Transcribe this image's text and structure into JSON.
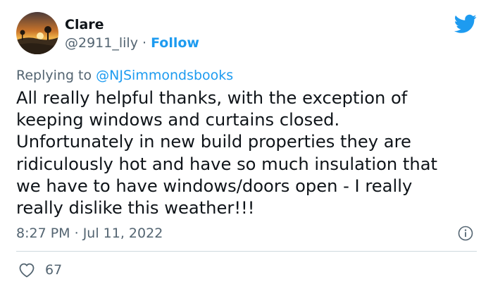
{
  "author": {
    "name": "Clare",
    "handle": "@2911_lily",
    "separator": "·",
    "follow_label": "Follow"
  },
  "reply": {
    "prefix": "Replying to",
    "handle": "@NJSimmondsbooks"
  },
  "tweet": {
    "text": "All really helpful thanks, with the exception of\nkeeping windows and curtains closed.\nUnfortunately in new build properties they are\nridiculously hot and have so much insulation that\nwe have to have windows/doors open - I really\nreally dislike this weather!!!"
  },
  "timestamp": {
    "time": "8:27 PM",
    "separator": "·",
    "date": "Jul 11, 2022"
  },
  "engagement": {
    "likes": "67"
  },
  "icons": {
    "brand": "twitter-bird-icon",
    "info": "info-icon",
    "like": "heart-icon"
  },
  "colors": {
    "accent": "#1d9bf0",
    "muted": "#536471",
    "text": "#0f1419",
    "divider": "#cfd9de"
  }
}
